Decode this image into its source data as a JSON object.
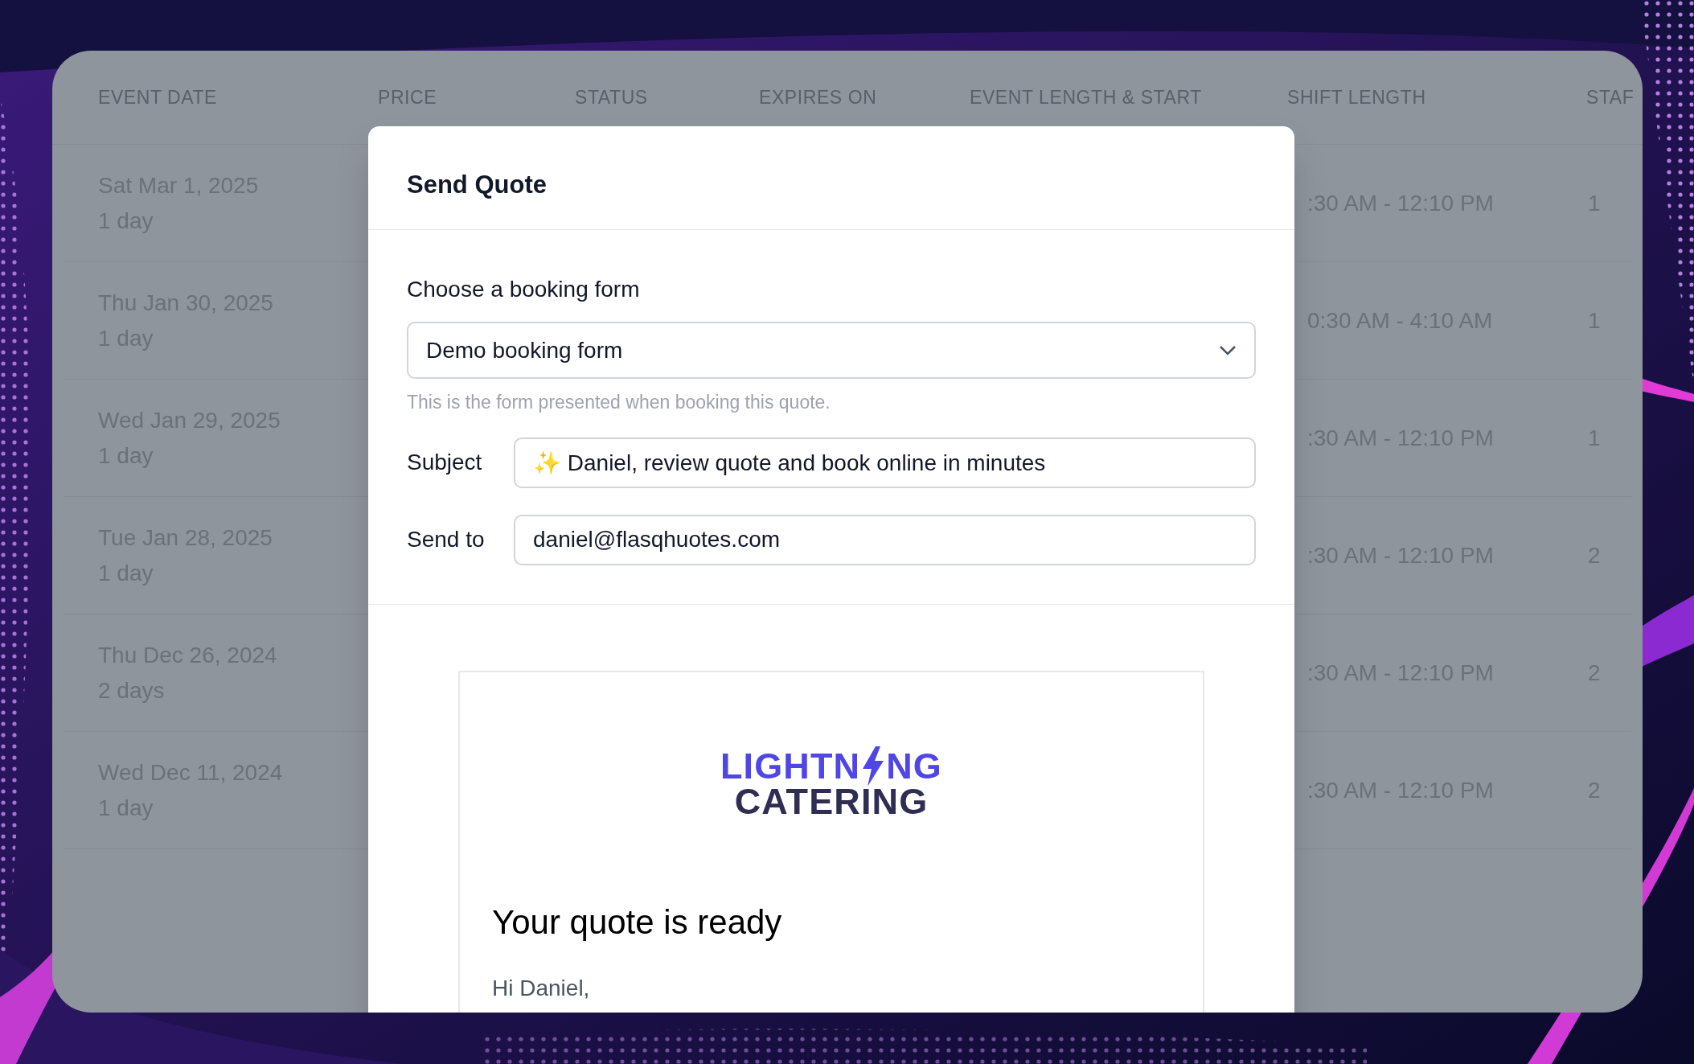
{
  "table": {
    "columns": [
      "EVENT DATE",
      "PRICE",
      "STATUS",
      "EXPIRES ON",
      "EVENT LENGTH & START",
      "SHIFT LENGTH",
      "STAF"
    ],
    "rows": [
      {
        "date": "Sat Mar 1, 2025",
        "length": "1 day",
        "shift": ":30 AM - 12:10 PM",
        "staff": "1"
      },
      {
        "date": "Thu Jan 30, 2025",
        "length": "1 day",
        "shift": "0:30 AM - 4:10 AM",
        "staff": "1"
      },
      {
        "date": "Wed Jan 29, 2025",
        "length": "1 day",
        "shift": ":30 AM - 12:10 PM",
        "staff": "1"
      },
      {
        "date": "Tue Jan 28, 2025",
        "length": "1 day",
        "shift": ":30 AM - 12:10 PM",
        "staff": "2"
      },
      {
        "date": "Thu Dec 26, 2024",
        "length": "2 days",
        "shift": ":30 AM - 12:10 PM",
        "staff": "2"
      },
      {
        "date": "Wed Dec 11, 2024",
        "length": "1 day",
        "shift": ":30 AM - 12:10 PM",
        "staff": "2"
      }
    ]
  },
  "modal": {
    "title": "Send Quote",
    "booking_form": {
      "label": "Choose a booking form",
      "value": "Demo booking form",
      "help": "This is the form presented when booking this quote."
    },
    "subject": {
      "label": "Subject",
      "value": "✨ Daniel, review quote and book online in minutes"
    },
    "send_to": {
      "label": "Send to",
      "value": "daniel@flasqhuotes.com"
    },
    "preview": {
      "logo": {
        "line_1_start": "LIGHTN",
        "line_1_end": "NG",
        "line_2": "CATERING"
      },
      "heading": "Your quote is ready",
      "greeting": "Hi Daniel,"
    }
  }
}
